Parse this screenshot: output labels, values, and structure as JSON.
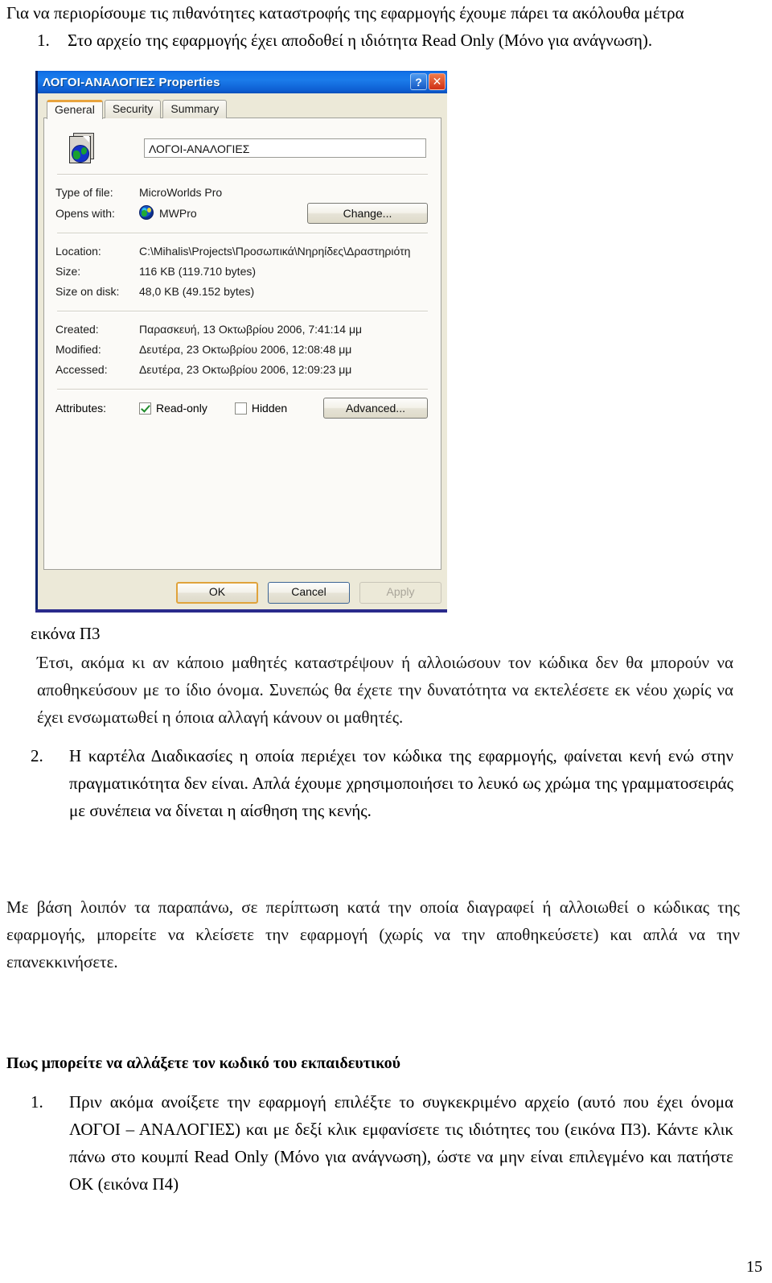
{
  "document": {
    "lead_paragraph": "Για να περιορίσουμε τις πιθανότητες καταστροφής της εφαρμογής έχουμε πάρει τα ακόλουθα μέτρα",
    "item1_number": "1.",
    "item1_text": "Στο αρχείο της εφαρμογής έχει αποδοθεί η ιδιότητα Read Only (Μόνο για ανάγνωση).",
    "figure_caption": "εικόνα Π3",
    "paragraph_after_figure": "Έτσι, ακόμα κι αν κάποιο μαθητές καταστρέψουν ή αλλοιώσουν τον κώδικα δεν θα μπορούν να αποθηκεύσουν με το ίδιο όνομα. Συνεπώς θα έχετε την δυνατότητα να εκτελέσετε εκ νέου χωρίς να έχει ενσωματωθεί η όποια αλλαγή κάνουν οι μαθητές.",
    "item2_number": "2.",
    "item2_text": "Η καρτέλα Διαδικασίες η οποία περιέχει τον κώδικα της εφαρμογής, φαίνεται κενή ενώ στην πραγματικότητα δεν είναι. Απλά έχουμε χρησιμοποιήσει το λευκό ως χρώμα της γραμματοσειράς με συνέπεια να δίνεται η αίσθηση της κενής.",
    "summary_paragraph": "Με βάση λοιπόν τα παραπάνω, σε περίπτωση κατά την οποία διαγραφεί ή αλλοιωθεί ο κώδικας της εφαρμογής, μπορείτε να κλείσετε την εφαρμογή (χωρίς να την αποθηκεύσετε) και απλά να την επανεκκινήσετε.",
    "section_heading": "Πως μπορείτε να αλλάξετε τον κωδικό του εκπαιδευτικού",
    "step1_number": "1.",
    "step1_text": "Πριν ακόμα ανοίξετε την εφαρμογή επιλέξτε το συγκεκριμένο αρχείο (αυτό που έχει όνομα ΛΟΓΟΙ – ΑΝΑΛΟΓΙΕΣ) και με δεξί κλικ εμφανίσετε τις ιδιότητες του (εικόνα Π3). Κάντε κλικ πάνω στο κουμπί Read Only (Μόνο για ανάγνωση), ώστε να μην είναι επιλεγμένο και πατήστε ΟΚ (εικόνα Π4)",
    "page_number": "15"
  },
  "dialog": {
    "title": "ΛΟΓΟΙ-ΑΝΑΛΟΓΙΕΣ Properties",
    "help_glyph": "?",
    "close_glyph": "✕",
    "tabs": [
      {
        "label": "General",
        "active": true
      },
      {
        "label": "Security",
        "active": false
      },
      {
        "label": "Summary",
        "active": false
      }
    ],
    "filename": "ΛΟΓΟΙ-ΑΝΑΛΟΓΙΕΣ",
    "fields": {
      "type_of_file_label": "Type of file:",
      "type_of_file_value": "MicroWorlds Pro",
      "opens_with_label": "Opens with:",
      "opens_with_value": "MWPro",
      "change_button": "Change...",
      "location_label": "Location:",
      "location_value": "C:\\Mihalis\\Projects\\Προσωπικά\\Νηρηίδες\\Δραστηριότη",
      "size_label": "Size:",
      "size_value": "116 KB (119.710 bytes)",
      "size_on_disk_label": "Size on disk:",
      "size_on_disk_value": "48,0 KB (49.152 bytes)",
      "created_label": "Created:",
      "created_value": "Παρασκευή, 13 Οκτωβρίου 2006, 7:41:14 μμ",
      "modified_label": "Modified:",
      "modified_value": "Δευτέρα, 23 Οκτωβρίου 2006, 12:08:48 μμ",
      "accessed_label": "Accessed:",
      "accessed_value": "Δευτέρα, 23 Οκτωβρίου 2006, 12:09:23 μμ",
      "attributes_label": "Attributes:",
      "readonly_label": "Read-only",
      "readonly_checked": true,
      "hidden_label": "Hidden",
      "hidden_checked": false,
      "advanced_button": "Advanced..."
    },
    "footer": {
      "ok": "OK",
      "cancel": "Cancel",
      "apply": "Apply"
    },
    "colors": {
      "titlebar_blue": "#1272e8",
      "dialog_face": "#ece9d8",
      "tab_active_accent": "#e8a33d",
      "check_green": "#1f8b2a",
      "close_red": "#cf3016",
      "bottom_rule": "#2a2a8c"
    }
  }
}
